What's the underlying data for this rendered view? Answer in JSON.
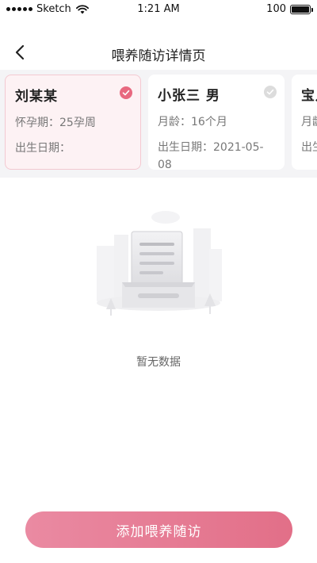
{
  "status_bar": {
    "carrier": "Sketch",
    "time": "1:21 AM",
    "battery": "100",
    "battery_level": 1.0
  },
  "nav": {
    "title": "喂养随访详情页",
    "back_icon": "chevron-left-icon"
  },
  "cards": [
    {
      "name": "刘某某",
      "line1": "怀孕期：25孕周",
      "line2": "出生日期：",
      "selected": true
    },
    {
      "name": "小张三 男",
      "line1": "月龄：16个月",
      "line2": "出生日期：2021-05-08",
      "selected": false
    },
    {
      "name": "宝儿",
      "line1": "月龄",
      "line2": "出生",
      "selected": false
    }
  ],
  "empty_state": {
    "illustration_icon": "empty-document-icon",
    "text": "暂无数据"
  },
  "actions": {
    "add_label": "添加喂养随访"
  },
  "colors": {
    "accent": "#e8687f",
    "card_selected_bg": "#fdf2f4",
    "strip_bg": "#f4f4f6"
  }
}
